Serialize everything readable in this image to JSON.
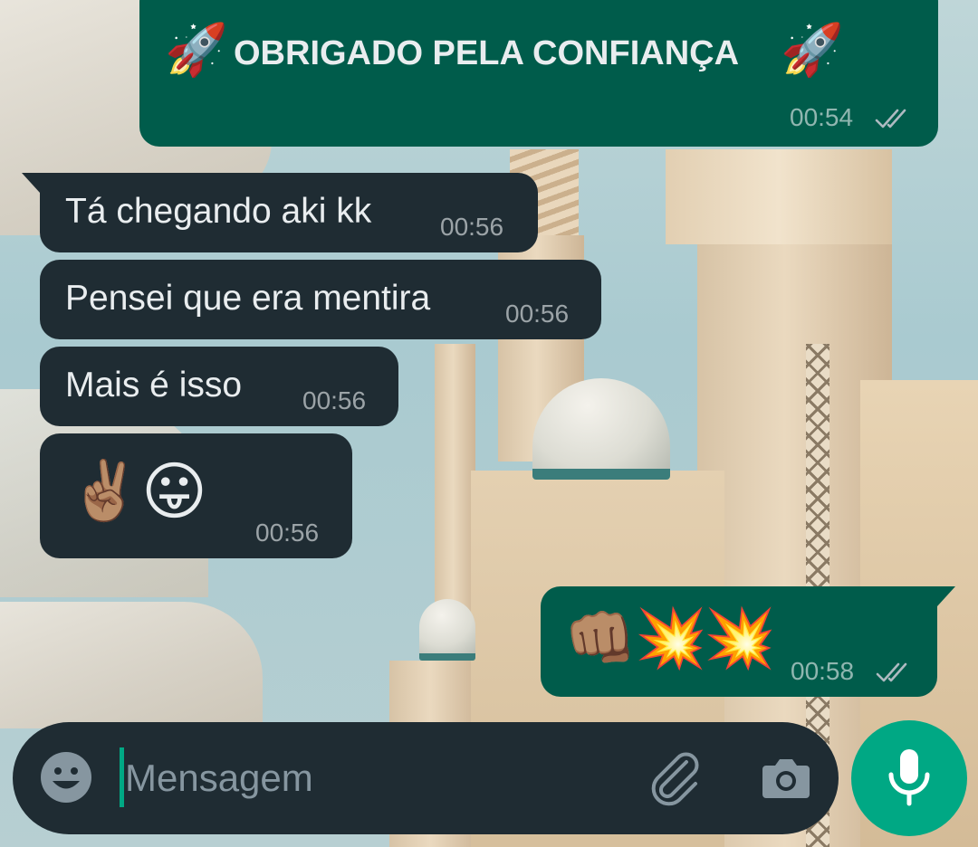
{
  "messages": [
    {
      "direction": "out",
      "text": "OBRIGADO PELA CONFIANÇA",
      "emoji_left": "🚀",
      "emoji_right": "🚀",
      "time": "00:54",
      "status": "delivered"
    },
    {
      "direction": "in",
      "text": "Tá chegando aki kk",
      "time": "00:56"
    },
    {
      "direction": "in",
      "text": "Pensei que era mentira",
      "time": "00:56"
    },
    {
      "direction": "in",
      "text": "Mais é isso",
      "time": "00:56"
    },
    {
      "direction": "in",
      "emojis": [
        "✌🏽",
        "😛"
      ],
      "time": "00:56"
    },
    {
      "direction": "out",
      "emojis": [
        "👊🏽",
        "💥",
        "💥"
      ],
      "time": "00:58",
      "status": "delivered"
    }
  ],
  "composer": {
    "placeholder": "Mensagem",
    "emoji_icon": "emoji-smiley-icon",
    "attach_icon": "paperclip-icon",
    "camera_icon": "camera-icon",
    "mic_icon": "microphone-icon"
  },
  "colors": {
    "incoming_bubble": "#1f2c33",
    "outgoing_bubble": "#005c4b",
    "accent": "#00a884",
    "text": "#e9edef",
    "meta_text": "#8696a0"
  }
}
